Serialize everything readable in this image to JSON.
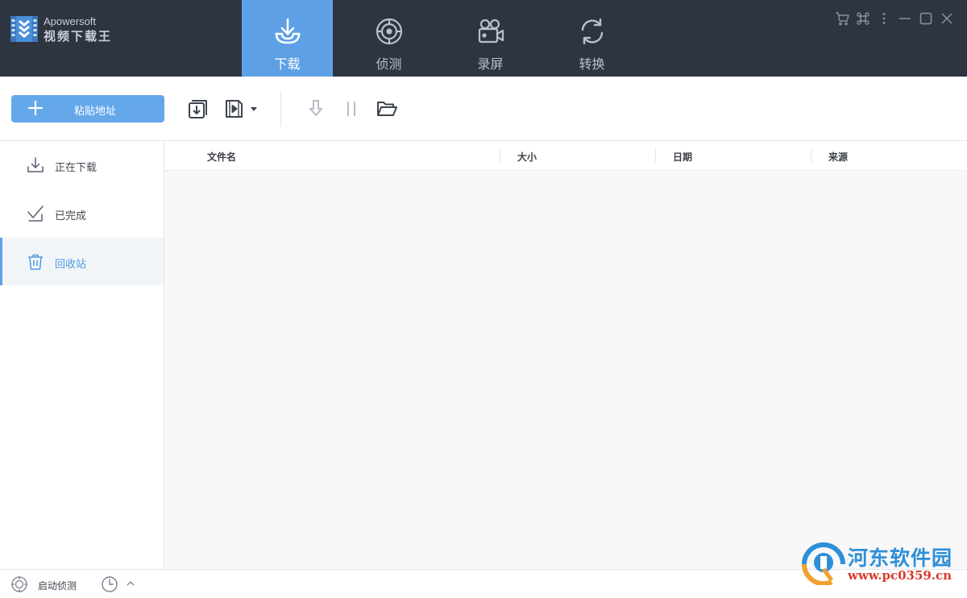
{
  "app": {
    "brand_line1": "Apowersoft",
    "brand_line2": "视频下载王",
    "accent_color": "#5ea0e6",
    "titlebar_color": "#2f3441"
  },
  "nav": {
    "tabs": [
      {
        "label": "下载",
        "icon": "download-tray-icon",
        "active": true
      },
      {
        "label": "侦测",
        "icon": "radar-target-icon",
        "active": false
      },
      {
        "label": "录屏",
        "icon": "video-camera-icon",
        "active": false
      },
      {
        "label": "转换",
        "icon": "convert-cycle-icon",
        "active": false
      }
    ]
  },
  "window_controls": [
    "cart-icon",
    "apps-command-icon",
    "more-vertical-icon",
    "minimize-icon",
    "maximize-icon",
    "close-icon"
  ],
  "toolbar": {
    "paste_label": "粘贴地址",
    "icons": [
      "import-download-icon",
      "video-file-dropdown-icon",
      "start-download-icon",
      "pause-icon",
      "open-folder-icon"
    ]
  },
  "sidebar": {
    "items": [
      {
        "label": "正在下载",
        "icon": "download-icon",
        "active": false
      },
      {
        "label": "已完成",
        "icon": "check-document-icon",
        "active": false
      },
      {
        "label": "回收站",
        "icon": "trash-icon",
        "active": true
      }
    ]
  },
  "table": {
    "columns": [
      "文件名",
      "大小",
      "日期",
      "来源"
    ],
    "rows": []
  },
  "statusbar": {
    "detect_label": "启动侦测"
  },
  "watermark": {
    "line1": "河东软件园",
    "line2": "www.pc0359.cn"
  }
}
